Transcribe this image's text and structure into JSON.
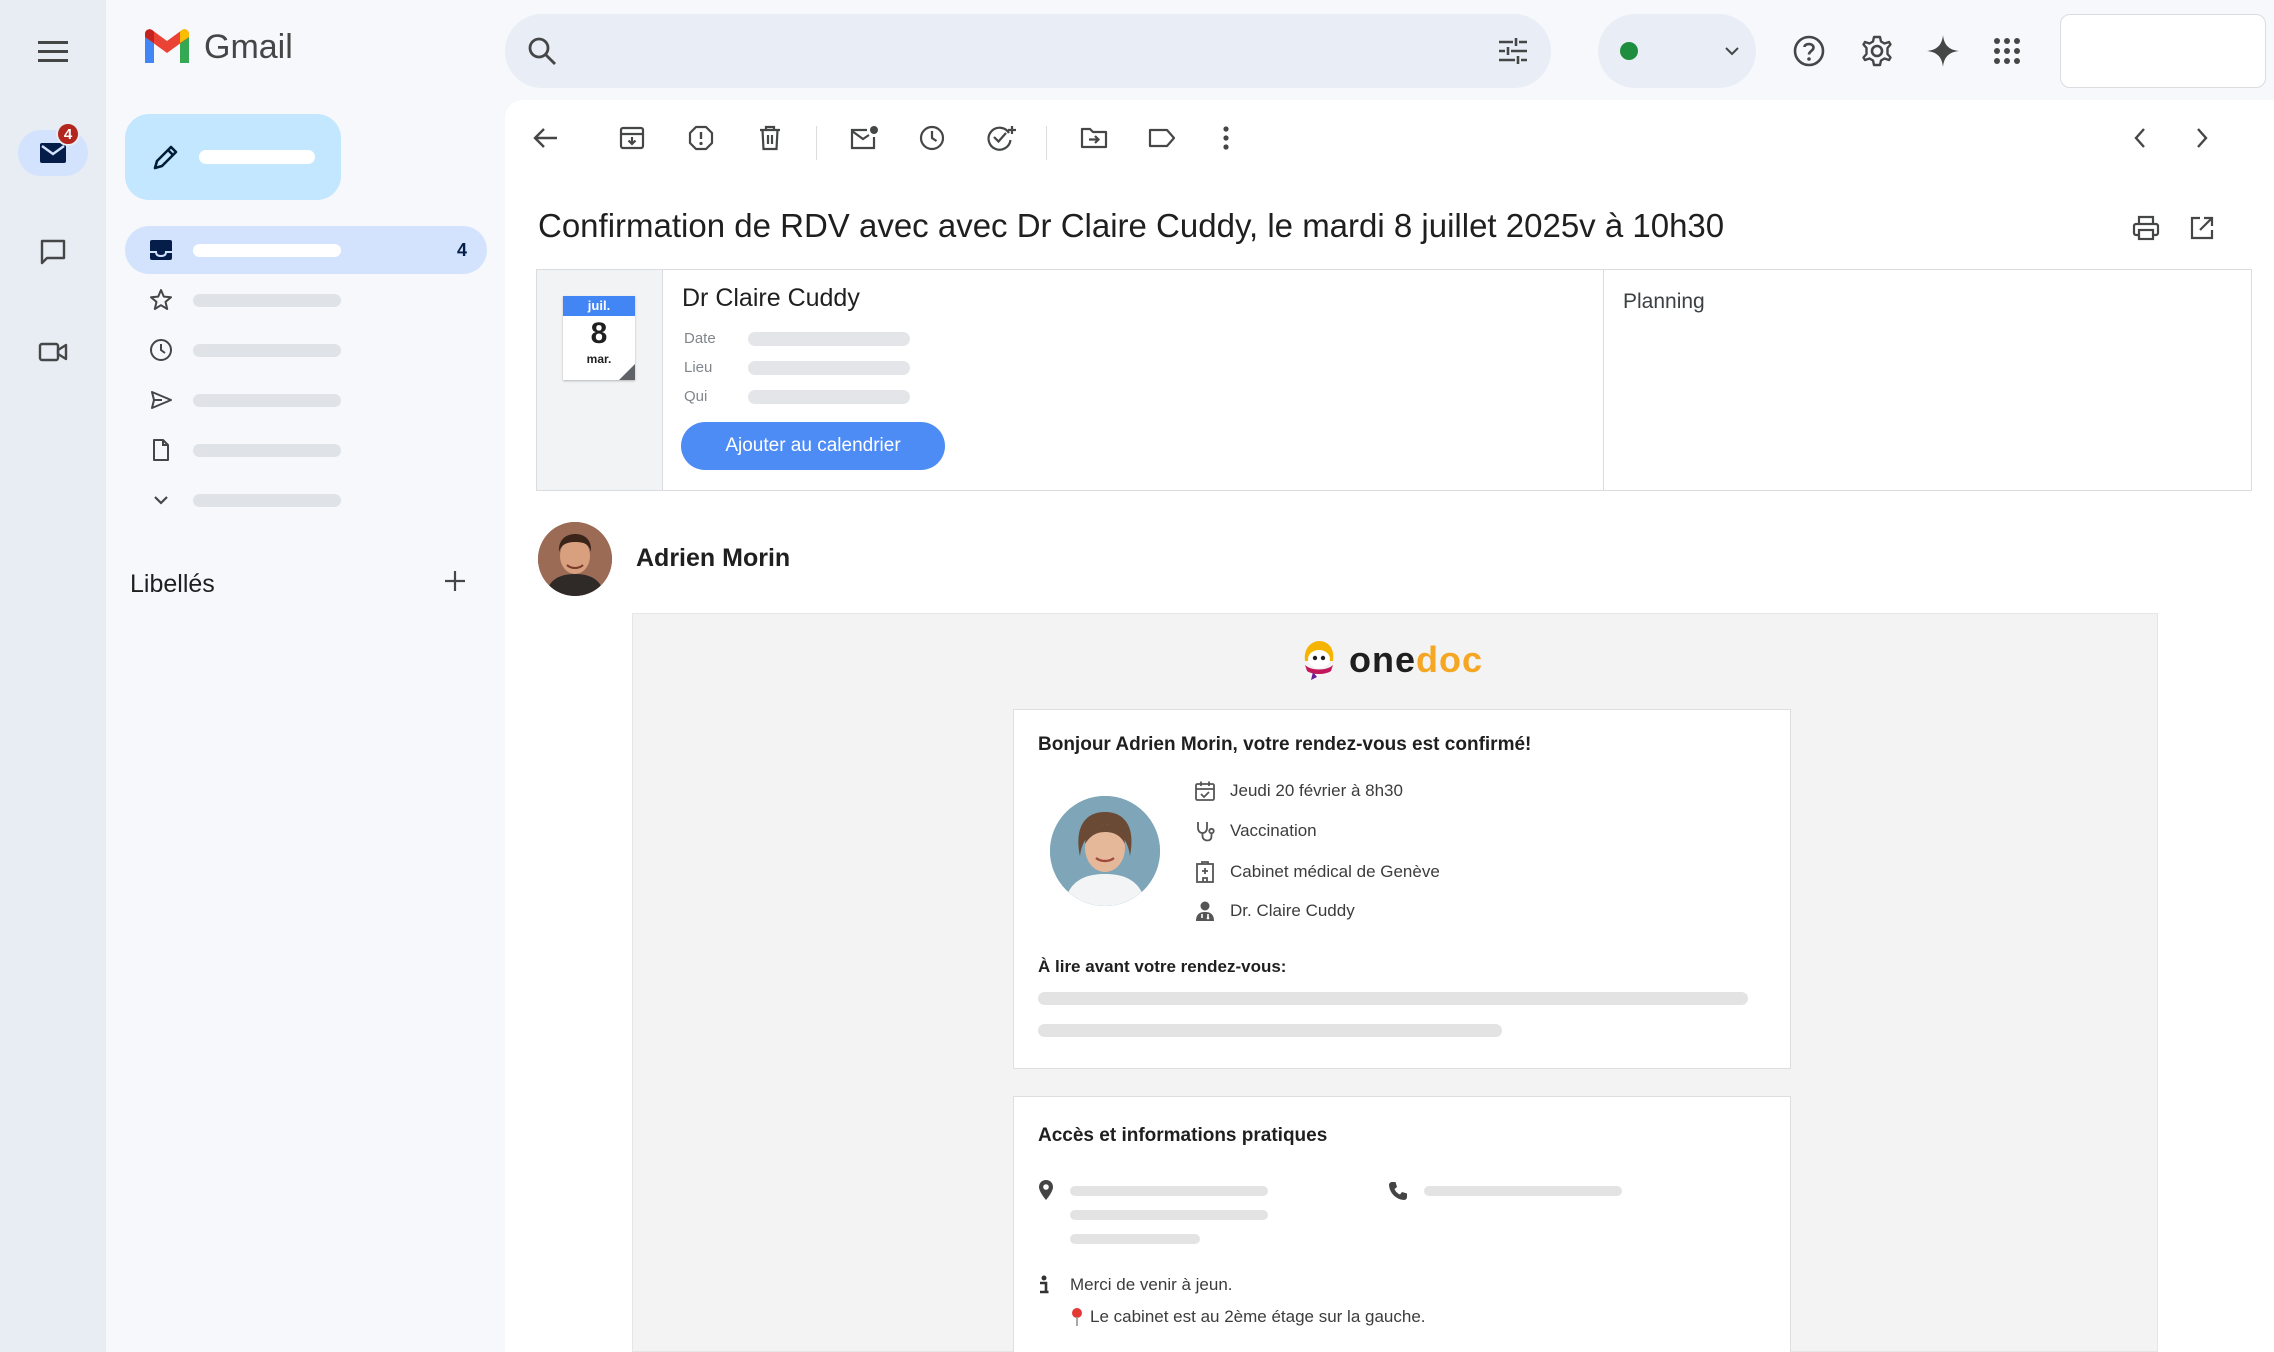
{
  "rail": {
    "mail_badge": "4"
  },
  "logo": {
    "text": "Gmail"
  },
  "nav": {
    "inbox_count": "4",
    "labels_title": "Libellés"
  },
  "search": {
    "placeholder": ""
  },
  "email": {
    "subject": "Confirmation de RDV avec avec Dr Claire Cuddy, le mardi 8 juillet 2025v à 10h30",
    "sender": "Adrien Morin"
  },
  "calendar_invite": {
    "month": "juil.",
    "day": "8",
    "weekday": "mar.",
    "event_title": "Dr Claire Cuddy",
    "rows": [
      "Date",
      "Lieu",
      "Qui"
    ],
    "add_button": "Ajouter au calendrier",
    "planning_label": "Planning"
  },
  "body": {
    "brand_one": "one",
    "brand_doc": "doc",
    "greeting": "Bonjour Adrien Morin, votre rendez-vous est confirmé!",
    "details": [
      "Jeudi 20 février à 8h30",
      "Vaccination",
      "Cabinet médical de Genève",
      "Dr. Claire Cuddy"
    ],
    "read_before": "À lire avant votre rendez-vous:",
    "access_title": "Accès et informations pratiques",
    "note_fasting": "Merci de venir à jeun.",
    "note_floor": "Le cabinet est au 2ème étage sur la gauche."
  },
  "colors": {
    "accent": "#4e8cf5",
    "compose": "#c2e7ff",
    "active_nav": "#d3e3fd",
    "badge": "#b3261e",
    "brand_orange": "#f5a623"
  }
}
